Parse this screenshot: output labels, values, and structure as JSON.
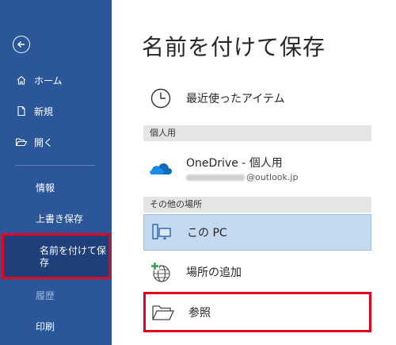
{
  "sidebar": {
    "items": [
      {
        "label": "ホーム",
        "icon": "home-icon"
      },
      {
        "label": "新規",
        "icon": "new-document-icon"
      },
      {
        "label": "開く",
        "icon": "folder-open-icon"
      },
      {
        "label": "情報"
      },
      {
        "label": "上書き保存"
      },
      {
        "label": "名前を付けて保存"
      },
      {
        "label": "履歴"
      },
      {
        "label": "印刷"
      }
    ]
  },
  "main": {
    "title": "名前を付けて保存",
    "recent_label": "最近使ったアイテム",
    "personal_header": "個人用",
    "onedrive_label": "OneDrive - 個人用",
    "onedrive_email": "@outlook.jp",
    "other_header": "その他の場所",
    "this_pc_label": "この PC",
    "add_place_label": "場所の追加",
    "browse_label": "参照"
  },
  "colors": {
    "sidebar": "#2b579a",
    "selected": "#c5d9f1",
    "highlight": "#e8001c",
    "onedrive": "#0f6cbd"
  }
}
